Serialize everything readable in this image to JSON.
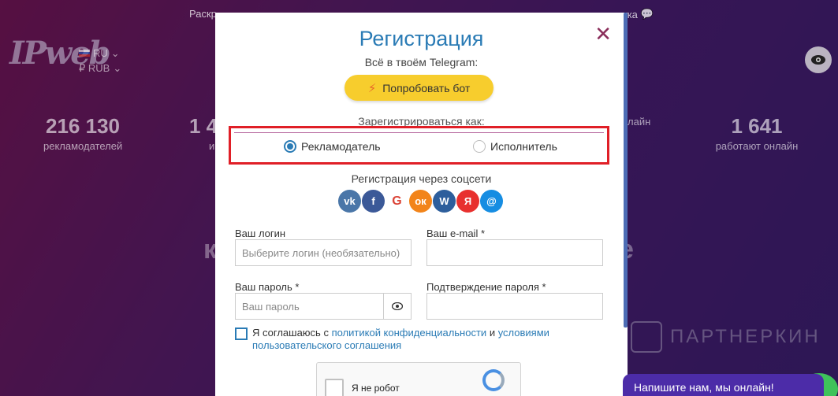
{
  "background": {
    "nav_left": "Раскр",
    "nav_right": "кка",
    "logo": "IPweb",
    "locale": {
      "language": "RU",
      "currency": "₽ RUB"
    },
    "stats": [
      {
        "num": "216 130",
        "label": "рекламодателей"
      },
      {
        "num": "1 4",
        "label": "и"
      },
      {
        "num": "",
        "label": "лайн"
      },
      {
        "num": "1 641",
        "label": "работают онлайн"
      }
    ],
    "bg_fragment_left": "к",
    "bg_fragment_right": "е",
    "watermark": "ПАРТНЕРКИН"
  },
  "modal": {
    "title": "Регистрация",
    "telegram_text": "Всё в твоём Telegram:",
    "bot_button": "Попробовать бот",
    "register_as": "Зарегистрироваться как:",
    "roles": [
      {
        "label": "Рекламодатель",
        "selected": true
      },
      {
        "label": "Исполнитель",
        "selected": false
      }
    ],
    "social_title": "Регистрация через соцсети",
    "socials": [
      {
        "name": "vk-icon",
        "glyph": "vk",
        "color": "#4a76a8"
      },
      {
        "name": "facebook-icon",
        "glyph": "f",
        "color": "#3b5998"
      },
      {
        "name": "google-icon",
        "glyph": "G",
        "color": "#ffffff"
      },
      {
        "name": "odnoklassniki-icon",
        "glyph": "ок",
        "color": "#f2841a"
      },
      {
        "name": "webmoney-icon",
        "glyph": "W",
        "color": "#2d5e9c"
      },
      {
        "name": "yandex-icon",
        "glyph": "Я",
        "color": "#e8302e"
      },
      {
        "name": "mailru-icon",
        "glyph": "@",
        "color": "#168de2"
      }
    ],
    "login_label": "Ваш логин",
    "login_placeholder": "Выберите логин (необязательно)",
    "email_label": "Ваш e-mail *",
    "password_label": "Ваш пароль *",
    "password_placeholder": "Ваш пароль",
    "confirm_label": "Подтверждение пароля *",
    "agree_prefix": "Я соглашаюсь с",
    "agree_link1": "политикой конфиденциальности",
    "agree_and": "и",
    "agree_link2": "условиями пользовательского соглашения",
    "captcha_text": "Я не робот"
  },
  "chat": {
    "text": "Напишите нам, мы онлайн!"
  },
  "colors": {
    "accent": "#2a7bb5",
    "highlight": "#e01f27",
    "bot_button": "#f7cd2d"
  }
}
